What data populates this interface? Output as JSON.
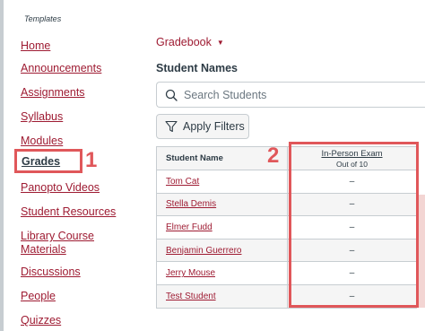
{
  "breadcrumb_label": "Templates",
  "course_nav": [
    {
      "label": "Home"
    },
    {
      "label": "Announcements"
    },
    {
      "label": "Assignments"
    },
    {
      "label": "Syllabus"
    },
    {
      "label": "Modules"
    },
    {
      "label": "Grades"
    },
    {
      "label": "Panopto Videos"
    },
    {
      "label": "Student Resources"
    },
    {
      "label": "Library Course"
    },
    {
      "label": "Materials"
    },
    {
      "label": "Discussions"
    },
    {
      "label": "People"
    },
    {
      "label": "Quizzes"
    }
  ],
  "annotations": {
    "step1": "1",
    "step2": "2",
    "color": "#e0575a"
  },
  "gradebook": {
    "menu_label": "Gradebook",
    "section_heading": "Student Names",
    "search_placeholder": "Search Students",
    "filter_label": "Apply Filters",
    "column_header_name": "Student Name",
    "assignment": {
      "title": "In-Person Exam",
      "points": "Out of 10"
    },
    "students": [
      {
        "name": "Tom Cat",
        "grade": "–"
      },
      {
        "name": "Stella Demis",
        "grade": "–"
      },
      {
        "name": "Elmer Fudd",
        "grade": "–"
      },
      {
        "name": "Benjamin Guerrero",
        "grade": "–"
      },
      {
        "name": "Jerry Mouse",
        "grade": "–"
      },
      {
        "name": "Test Student",
        "grade": "–"
      }
    ]
  },
  "colors": {
    "link": "#9e1b32",
    "text": "#2d3b45",
    "border": "#c7cdd1",
    "highlight": "#e0575a"
  }
}
